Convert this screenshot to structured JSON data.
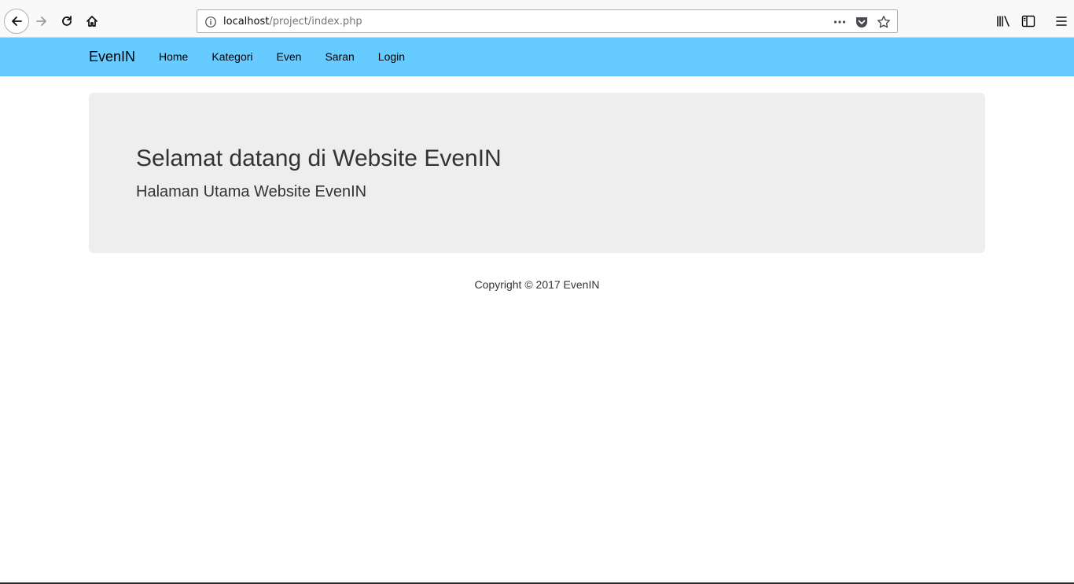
{
  "browser": {
    "url_host": "localhost",
    "url_path": "/project/index.php",
    "icons": {
      "back": "back-arrow-icon",
      "forward": "forward-arrow-icon",
      "reload": "reload-icon",
      "home": "home-icon",
      "info": "info-icon",
      "page_actions": "more-dots-icon",
      "pocket": "pocket-icon",
      "bookmark": "star-icon",
      "library": "library-icon",
      "sidebar": "sidebar-icon",
      "menu": "hamburger-menu-icon"
    }
  },
  "navbar": {
    "brand": "EvenIN",
    "items": [
      {
        "label": "Home"
      },
      {
        "label": "Kategori"
      },
      {
        "label": "Even"
      },
      {
        "label": "Saran"
      },
      {
        "label": "Login"
      }
    ],
    "background_color": "#66ccff"
  },
  "jumbotron": {
    "title": "Selamat datang di Website EvenIN",
    "subtitle": "Halaman Utama Website EvenIN",
    "background_color": "#eeeeee"
  },
  "footer": {
    "copyright": "Copyright © 2017 EvenIN"
  }
}
